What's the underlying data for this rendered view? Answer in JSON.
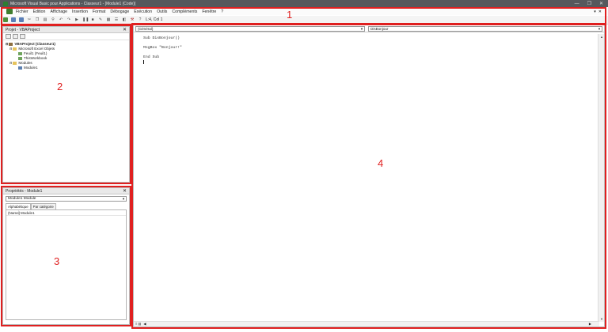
{
  "window": {
    "title": "Microsoft Visual Basic pour Applications - Classeur1 - [Module1 (Code)]",
    "minimize": "—",
    "maximize": "❐",
    "close": "✕"
  },
  "menu": {
    "items": [
      "Fichier",
      "Edition",
      "Affichage",
      "Insertion",
      "Format",
      "Débogage",
      "Exécution",
      "Outils",
      "Compléments",
      "Fenêtre",
      "?"
    ],
    "right_icons": [
      "▾",
      "✕"
    ]
  },
  "toolbar": {
    "position": "L:4, Col 1"
  },
  "callouts": [
    "1",
    "2",
    "3",
    "4"
  ],
  "project_explorer": {
    "title": "Projet - VBAProject",
    "close": "✕",
    "tree": {
      "project": "VBAProject (Classeur1)",
      "excel_objects": "Microsoft Excel Objets",
      "sheet1": "Feuil1 (Feuil1)",
      "workbook": "ThisWorkbook",
      "modules": "Modules",
      "module1": "Module1"
    }
  },
  "properties": {
    "title": "Propriétés - Module1",
    "close": "✕",
    "object_select": "Module1 Module",
    "tabs": [
      "Alphabétique",
      "Par catégorie"
    ],
    "rows": [
      {
        "key": "(Name)",
        "value": "Module1"
      }
    ]
  },
  "code": {
    "object_combo": "(Général)",
    "procedure_combo": "DisBonjour",
    "lines": [
      "Sub DisBonjour()",
      "",
      "MsgBox \"Bonjour!\"",
      "",
      "End Sub",
      ""
    ]
  }
}
